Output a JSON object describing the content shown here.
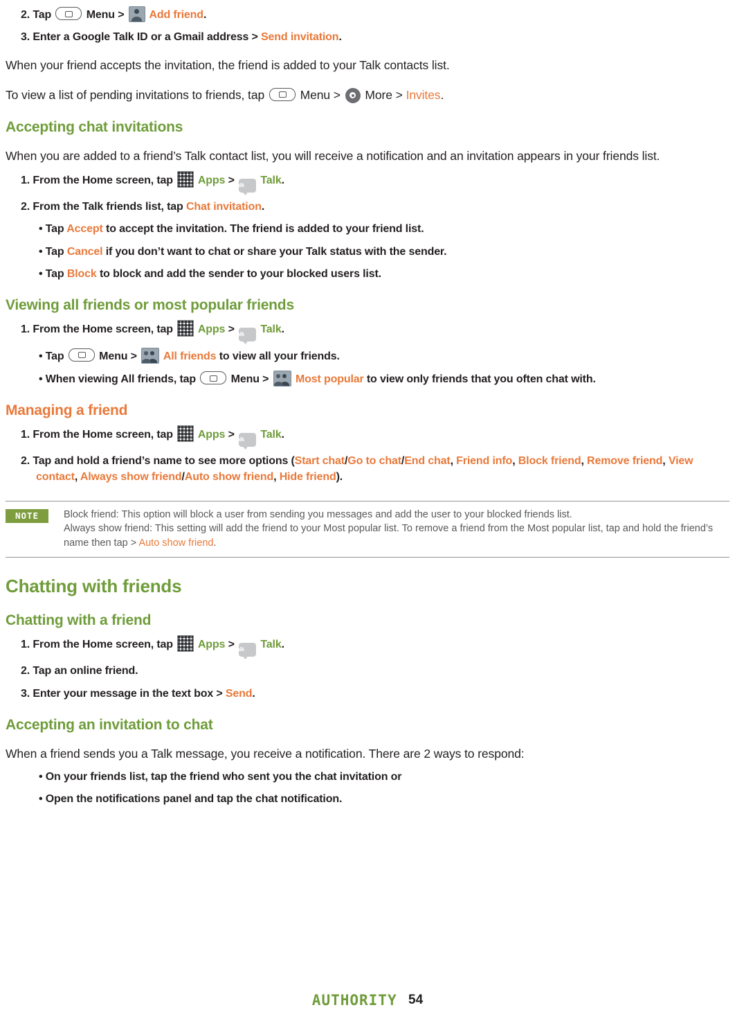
{
  "steps_top": {
    "step2": {
      "num": "2. Tap",
      "menu": "Menu",
      "gt": ">",
      "add_friend": "Add friend",
      "period": "."
    },
    "step3": {
      "text": "3. Enter a Google Talk ID or a Gmail address >",
      "link": "Send invitation",
      "period": "."
    }
  },
  "paragraphs": {
    "accept_invite": "When your friend accepts the invitation, the friend is added to your Talk contacts list.",
    "view_pending_pre": "To view a list of pending invitations to friends, tap",
    "menu": "Menu",
    "gt": ">",
    "more": "More",
    "invites": "Invites",
    "period": "."
  },
  "accepting_chat_invitations": {
    "heading": "Accepting chat invitations",
    "intro": "When you are added to a friend’s Talk contact list, you will receive a notification and an invitation appears in your friends list.",
    "step1": {
      "pre": "1. From the Home screen, tap",
      "apps": "Apps",
      "gt": ">",
      "talk": "Talk",
      "period": "."
    },
    "step2": {
      "pre": "2. From the Talk friends list, tap",
      "link": "Chat invitation",
      "period": "."
    },
    "bullets": [
      {
        "bullet": "•",
        "pre": "Tap",
        "link": "Accept",
        "post": "to accept the invitation. The friend is added to your friend list."
      },
      {
        "bullet": "•",
        "pre": "Tap",
        "link": "Cancel",
        "post": "if you don’t want to chat or share your Talk status with the sender."
      },
      {
        "bullet": "•",
        "pre": "Tap",
        "link": "Block",
        "post": "to block and add the sender to your blocked users list."
      }
    ]
  },
  "viewing_friends": {
    "heading": "Viewing all friends or most popular friends",
    "step1": {
      "pre": "1. From the Home screen, tap",
      "apps": "Apps",
      "gt": ">",
      "talk": "Talk",
      "period": "."
    },
    "bullet1": {
      "bullet": "•",
      "pre": "Tap",
      "menu": "Menu",
      "gt": ">",
      "link": "All friends",
      "post": "to view all your friends."
    },
    "bullet2": {
      "bullet": "•",
      "pre": "When viewing All friends, tap",
      "menu": "Menu",
      "gt": ">",
      "link": "Most popular",
      "post": "to view only friends that you often chat with."
    }
  },
  "managing_friend": {
    "heading": "Managing a friend",
    "step1": {
      "pre": "1. From the Home screen, tap",
      "apps": "Apps",
      "gt": ">",
      "talk": "Talk",
      "period": "."
    },
    "step2": {
      "pre": "2. Tap and hold a friend’s name to see more options (",
      "opt1": "Start chat",
      "sep1": "/",
      "opt2": "Go to chat",
      "sep2": "/",
      "opt3": "End chat",
      "comma1": ",",
      "opt4": "Friend info",
      "comma2": ",",
      "opt5": "Block friend",
      "comma3": ",",
      "opt6": "Remove friend",
      "comma4": ",",
      "opt7": "View contact",
      "comma5": ",",
      "opt8": "Always show friend",
      "sep3": "/",
      "opt9": "Auto show friend",
      "comma6": ",",
      "opt10": "Hide friend",
      "close": ")."
    }
  },
  "note": {
    "badge": "NOTE",
    "line1": "Block friend: This option will block a user from sending you messages and add the user to your blocked friends list.",
    "line2": "Always show friend: This setting will add the friend to your Most popular list. To remove a friend from the Most popular list, tap and hold the friend’s name then tap >",
    "link": "Auto show friend",
    "period": "."
  },
  "chatting_with_friends": {
    "heading": "Chatting with friends",
    "sub_heading": "Chatting with a friend",
    "step1": {
      "pre": "1. From the Home screen, tap",
      "apps": "Apps",
      "gt": ">",
      "talk": "Talk",
      "period": "."
    },
    "step2": "2. Tap an online friend.",
    "step3": {
      "pre": "3. Enter your message in the text box >",
      "link": "Send",
      "period": "."
    }
  },
  "accepting_invitation_chat": {
    "heading": "Accepting an invitation to chat",
    "intro": "When a friend sends you a Talk message, you receive a notification. There are 2 ways to respond:",
    "bullets": [
      {
        "bullet": "•",
        "text": "On your friends list, tap the friend who sent you the chat invitation or"
      },
      {
        "bullet": "•",
        "text": "Open the notifications panel and tap the chat notification."
      }
    ]
  },
  "footer": {
    "brand": "AUTHORITY",
    "page": "54"
  },
  "icons": {
    "menu": "menu-key-icon",
    "apps": "apps-grid-icon",
    "talk": "talk-app-icon",
    "add_friend": "add-friend-icon",
    "all_friends": "all-friends-icon",
    "most_popular": "most-popular-icon",
    "more": "more-options-icon"
  },
  "colors": {
    "green": "#6f9c3a",
    "orange": "#e8793a",
    "body": "#231f20",
    "note_text": "#58595b"
  }
}
